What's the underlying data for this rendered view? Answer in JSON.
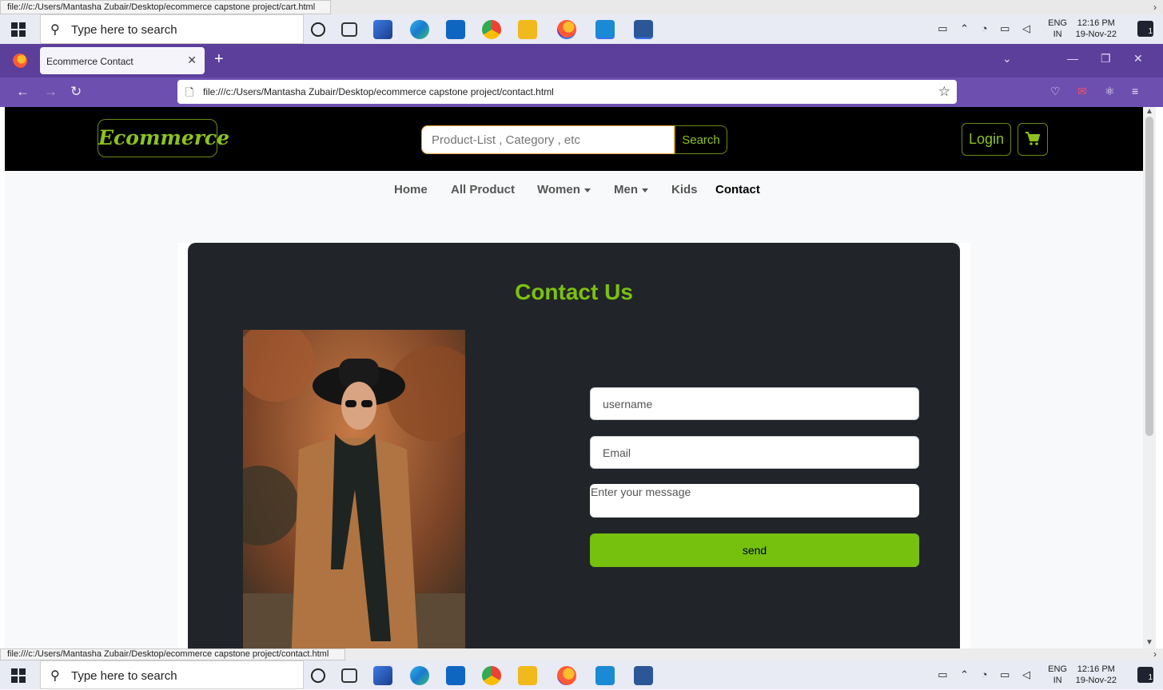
{
  "top_status_url": "file:///c:/Users/Mantasha Zubair/Desktop/ecommerce capstone project/cart.html",
  "bottom_status_url": "file:///c:/Users/Mantasha Zubair/Desktop/ecommerce capstone project/contact.html",
  "taskbar": {
    "search_placeholder": "Type here to search",
    "lang_top": "ENG",
    "lang_bottom": "IN",
    "time": "12:16 PM",
    "date": "19-Nov-22",
    "notification_count": "1",
    "apps": [
      "cortana-icon",
      "task-view-icon",
      "app-icon",
      "edge-icon",
      "mail-icon",
      "chrome-icon",
      "file-explorer-icon",
      "firefox-icon",
      "vscode-icon",
      "word-icon"
    ]
  },
  "browser": {
    "tab_title": "Ecommerce Contact",
    "address": "file:///c:/Users/Mantasha Zubair/Desktop/ecommerce capstone project/contact.html"
  },
  "site": {
    "brand": "Ecommerce",
    "search_placeholder": "Product-List , Category , etc",
    "search_button": "Search",
    "login_button": "Login",
    "nav": [
      {
        "label": "Home"
      },
      {
        "label": "All Product"
      },
      {
        "label": "Women"
      },
      {
        "label": "Men"
      },
      {
        "label": "Kids"
      },
      {
        "label": "Contact"
      }
    ],
    "accent_color": "#7cc110"
  },
  "contact": {
    "title": "Contact Us",
    "username_placeholder": "username",
    "email_placeholder": "Email",
    "message_placeholder": "Enter your message",
    "send_button": "send"
  }
}
